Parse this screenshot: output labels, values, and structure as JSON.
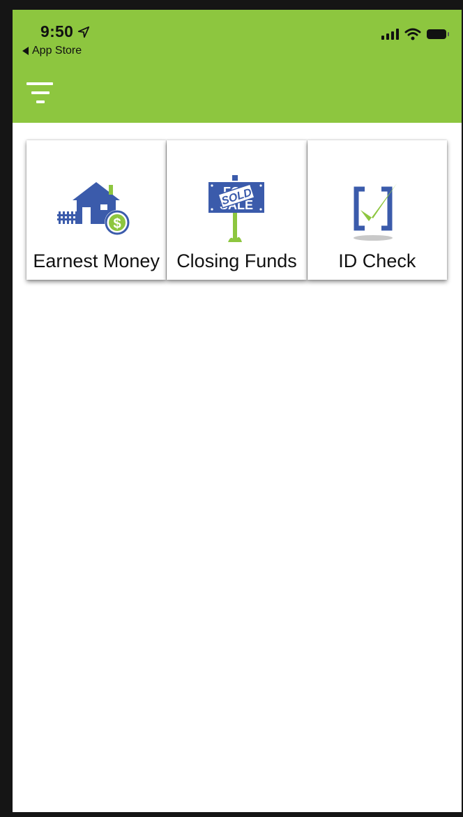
{
  "status_bar": {
    "time": "9:50",
    "back_label": "App Store"
  },
  "appbar": {
    "color": "#8dc63f",
    "menu_icon": "filter-menu-icon"
  },
  "tiles": [
    {
      "label": "Earnest Money",
      "icon": "house-dollar-icon"
    },
    {
      "label": "Closing Funds",
      "icon": "sold-sign-icon"
    },
    {
      "label": "ID Check",
      "icon": "checkbox-check-icon"
    }
  ],
  "colors": {
    "brand_green": "#8dc63f",
    "brand_blue": "#3b5bab"
  }
}
